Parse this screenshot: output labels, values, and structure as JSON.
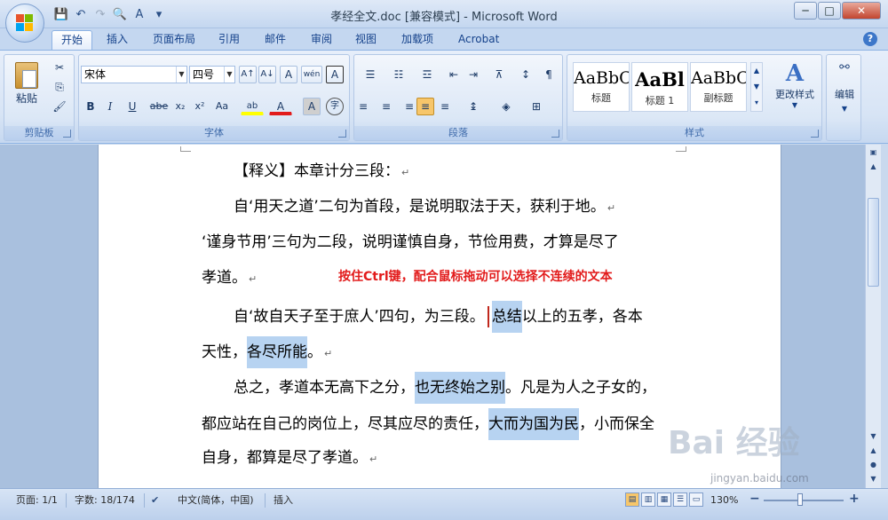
{
  "window": {
    "title": "孝经全文.doc [兼容模式] - Microsoft Word",
    "controls": [
      "─",
      "□",
      "✕"
    ]
  },
  "quick_access": {
    "icons": [
      "save-icon",
      "undo-icon",
      "redo-icon",
      "print-preview-icon",
      "spelling-icon",
      "customize-icon"
    ],
    "glyphs": [
      "💾",
      "↶",
      "↷",
      "🔍",
      "A",
      "▾"
    ]
  },
  "tabs": [
    "开始",
    "插入",
    "页面布局",
    "引用",
    "邮件",
    "审阅",
    "视图",
    "加载项",
    "Acrobat"
  ],
  "active_tab": "开始",
  "ribbon": {
    "clipboard": {
      "label": "剪贴板",
      "paste": "粘贴",
      "cut": "✂",
      "copy": "⎘",
      "format_painter": "🖌"
    },
    "font": {
      "label": "字体",
      "font_name": "宋体",
      "font_size": "四号",
      "grow": "A↑",
      "shrink": "A↓",
      "clear": "A",
      "pinyin": "wén",
      "border": "A",
      "bold": "B",
      "italic": "I",
      "underline": "U",
      "strike": "abe",
      "subscript": "x₂",
      "superscript": "x²",
      "case": "Aa",
      "highlight": "ab",
      "font_color": "A",
      "shade": "A",
      "enclose": "字"
    },
    "paragraph": {
      "label": "段落",
      "bullets": "☰",
      "numbering": "☷",
      "multilevel": "☲",
      "decrease": "⇤",
      "increase": "⇥",
      "chinese_layout": "⊼",
      "sort": "↕",
      "show_marks": "¶",
      "align_left": "≡",
      "center": "≡",
      "align_right": "≡",
      "justify": "≡",
      "distribute": "≡",
      "line_spacing": "↨",
      "shading": "◈",
      "borders": "⊞"
    },
    "styles": {
      "label": "样式",
      "items": [
        {
          "preview": "AaBbC",
          "name": "标题"
        },
        {
          "preview": "AaBl",
          "name": "标题 1"
        },
        {
          "preview": "AaBbC",
          "name": "副标题"
        }
      ],
      "change_styles": "更改样式"
    },
    "editing": {
      "label": "编辑"
    },
    "help": "?"
  },
  "document": {
    "lines": [
      {
        "text": "【释义】本章计分三段：",
        "indent": true
      },
      {
        "text": "自‘用天之道’二句为首段，是说明取法于天，获利于地。",
        "indent": true
      },
      {
        "text": "‘谨身节用’三句为二段，说明谨慎自身，节俭用费，才算是尽了",
        "indent": false
      },
      {
        "text": "孝道。",
        "indent": false
      },
      {
        "parts": [
          "自‘故自天子至于庶人’四句，为三段。",
          "总结",
          "以上的五孝，各本"
        ],
        "indent": true
      },
      {
        "parts": [
          "天性，",
          "各尽所能",
          "。"
        ],
        "indent": false
      },
      {
        "parts": [
          "总之，孝道本无高下之分，",
          "也无终始之别",
          "。凡是为人之子女的，"
        ],
        "indent": true
      },
      {
        "parts": [
          "都应站在自己的岗位上，尽其应尽的责任，",
          "大而为国为民",
          "，小而保全"
        ],
        "indent": false
      },
      {
        "text": "自身，都算是尽了孝道。",
        "indent": false
      }
    ],
    "paragraph_mark": "↵",
    "annotation": "按住Ctrl键，配合鼠标拖动可以选择不连续的文本"
  },
  "status_bar": {
    "page": "页面: 1/1",
    "words": "字数: 18/174",
    "language": "中文(简体，中国)",
    "mode": "插入",
    "zoom": "130%",
    "zoom_out": "−",
    "zoom_in": "+"
  },
  "watermark": {
    "logo": "Bai 经验",
    "url": "jingyan.baidu.com"
  },
  "colors": {
    "annotation": "#e21b1b",
    "selection": "#b7d3f1",
    "ribbon": "#dbe7f6"
  }
}
